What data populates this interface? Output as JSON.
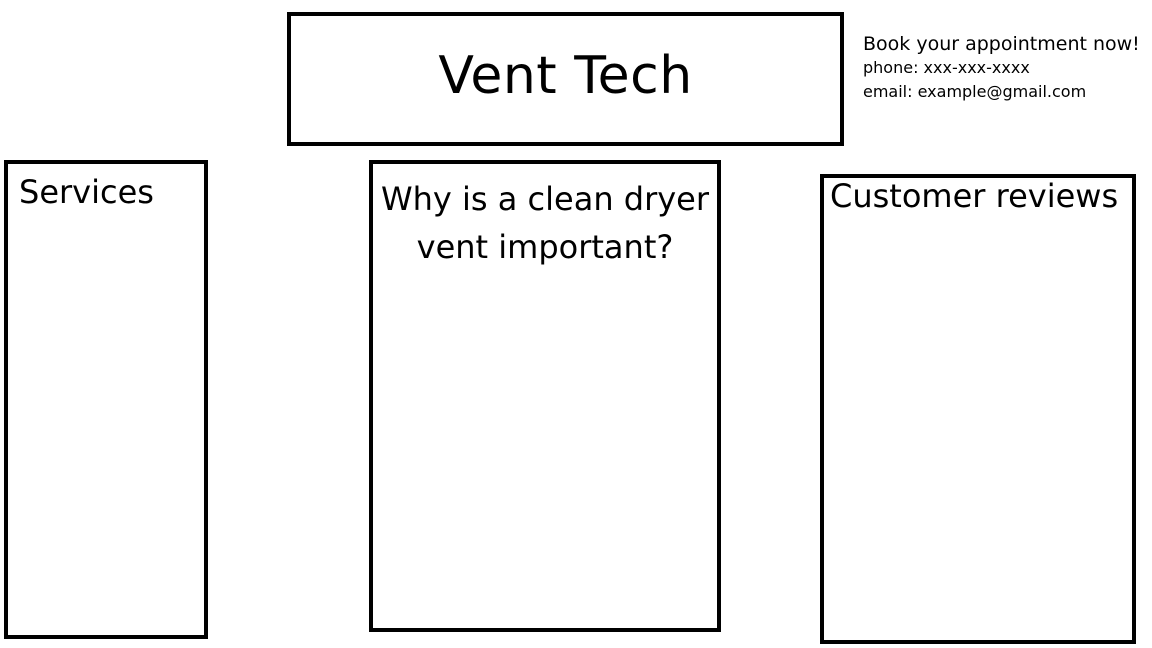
{
  "header": {
    "title": "Vent Tech"
  },
  "contact": {
    "heading": "Book your appointment now!",
    "phone": "phone: xxx-xxx-xxxx",
    "email": "email: example@gmail.com"
  },
  "panels": {
    "services": {
      "heading": "Services"
    },
    "why_clean": {
      "heading": "Why is a clean dryer vent important?"
    },
    "reviews": {
      "heading": "Customer reviews"
    }
  }
}
